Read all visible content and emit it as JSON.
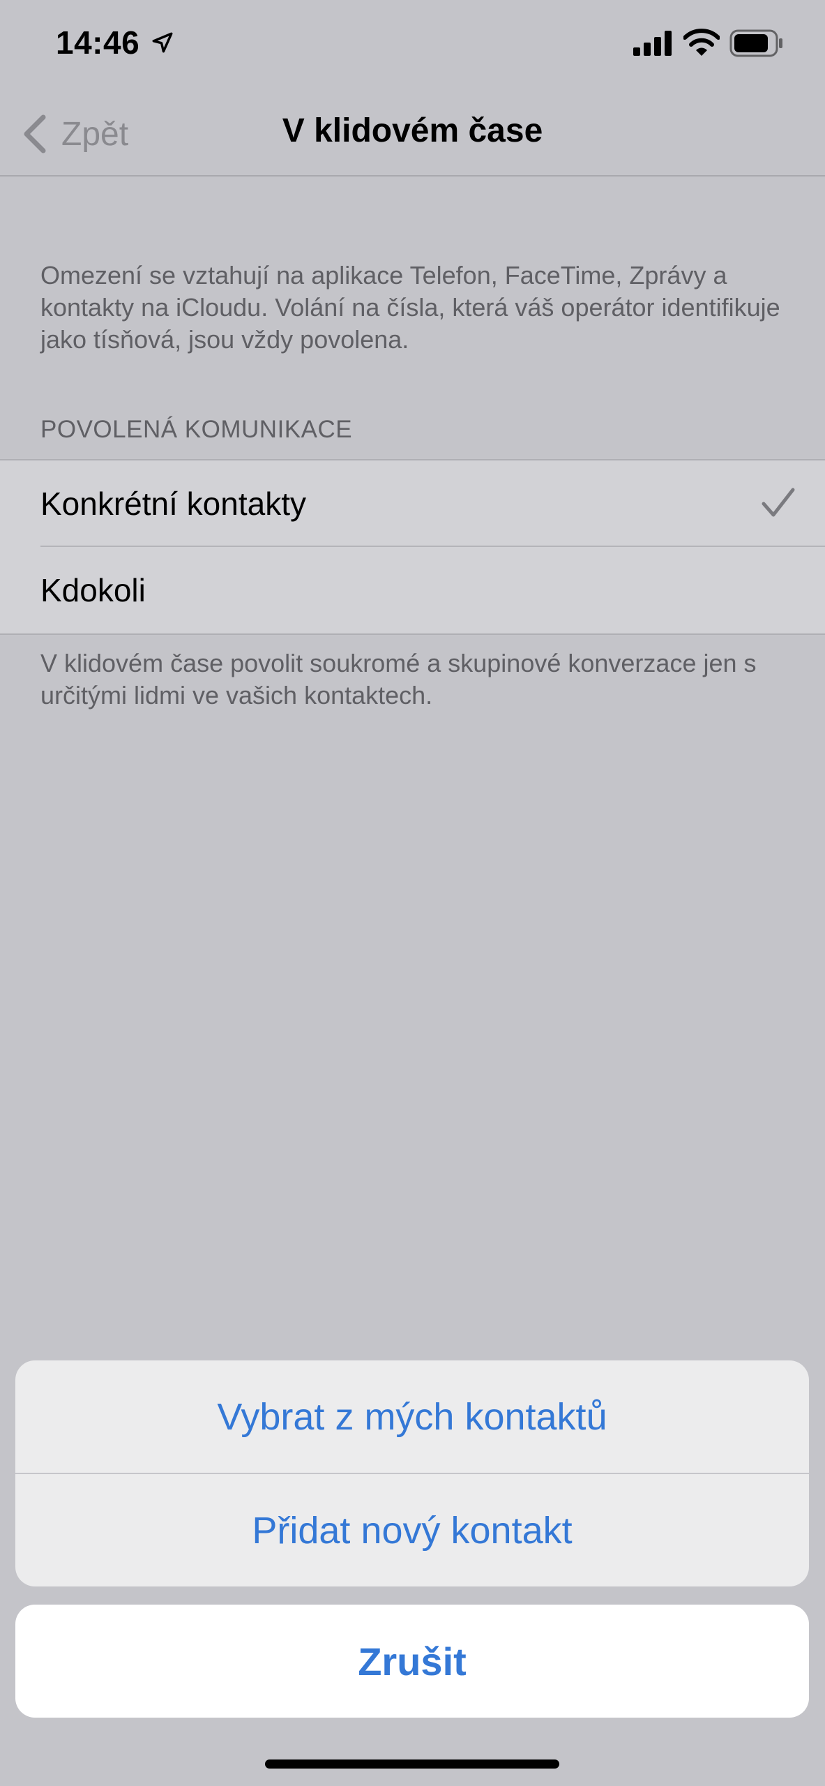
{
  "status_bar": {
    "time": "14:46",
    "icons": [
      "location-arrow-icon",
      "signal-icon",
      "wifi-icon",
      "battery-icon"
    ]
  },
  "nav": {
    "back_label": "Zpět",
    "title": "V klidovém čase"
  },
  "intro_text": "Omezení se vztahují na aplikace Telefon, FaceTime, Zprávy a kontakty na iCloudu. Volání na čísla, která váš operátor identifikuje jako tísňová, jsou vždy povolena.",
  "section": {
    "header": "POVOLENÁ KOMUNIKACE",
    "options": [
      {
        "label": "Konkrétní kontakty",
        "selected": true
      },
      {
        "label": "Kdokoli",
        "selected": false
      }
    ],
    "footer": "V klidovém čase povolit soukromé a skupinové konverzace jen s určitými lidmi ve vašich kontaktech."
  },
  "action_sheet": {
    "actions": [
      "Vybrat z mých kontaktů",
      "Přidat nový kontakt"
    ],
    "cancel_label": "Zrušit"
  },
  "colors": {
    "accent": "#3478d6",
    "dim_background": "#c4c4c9"
  }
}
